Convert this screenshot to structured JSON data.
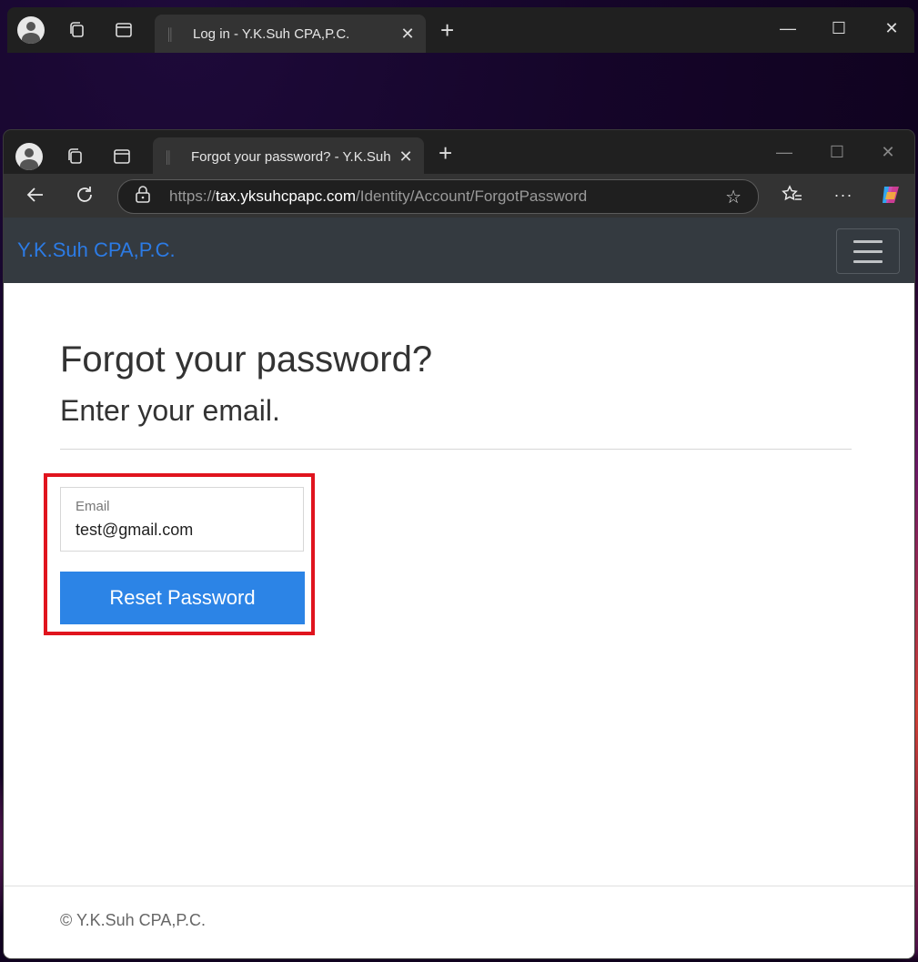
{
  "background_browser": {
    "tab_title": "Log in - Y.K.Suh CPA,P.C.",
    "new_tab_symbol": "+",
    "controls": {
      "minimize": "—",
      "maximize": "☐",
      "close": "✕"
    }
  },
  "browser": {
    "tab_title": "Forgot your password? - Y.K.Suh C",
    "new_tab_symbol": "+",
    "controls": {
      "minimize": "—",
      "maximize": "☐",
      "close": "✕"
    },
    "url_scheme": "https://",
    "url_host": "tax.yksuhcpapc.com",
    "url_path": "/Identity/Account/ForgotPassword"
  },
  "site": {
    "brand": "Y.K.Suh CPA,P.C.",
    "brand_color": "#2c7be5"
  },
  "page": {
    "title": "Forgot your password?",
    "subtitle": "Enter your email.",
    "email_label": "Email",
    "email_value": "test@gmail.com",
    "reset_button": "Reset Password",
    "button_color": "#2c84e6",
    "highlight_color": "#e0141e",
    "footer": "© Y.K.Suh CPA,P.C."
  },
  "icons": [
    "profile-icon",
    "workspaces-icon",
    "tab-actions-icon",
    "tab-favicon",
    "close-tab-icon",
    "back-icon",
    "refresh-icon",
    "lock-icon",
    "favorite-star-icon",
    "favorites-icon",
    "more-icon",
    "copilot-icon",
    "hamburger-icon"
  ]
}
